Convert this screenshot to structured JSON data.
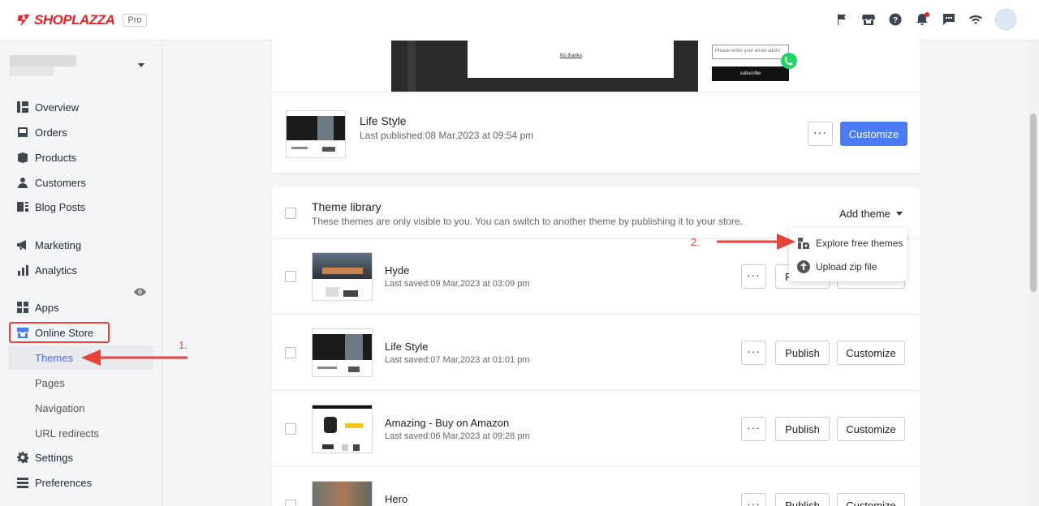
{
  "header": {
    "brand": "SHOPLAZZA",
    "plan": "Pro",
    "icons": [
      "flag-icon",
      "store-icon",
      "help-icon",
      "bell-icon",
      "chat-icon",
      "wifi-icon"
    ]
  },
  "sidebar": {
    "items": [
      {
        "label": "Overview",
        "icon": "overview-icon"
      },
      {
        "label": "Orders",
        "icon": "orders-icon"
      },
      {
        "label": "Products",
        "icon": "products-icon"
      },
      {
        "label": "Customers",
        "icon": "customers-icon"
      },
      {
        "label": "Blog Posts",
        "icon": "blog-icon"
      },
      {
        "label": "Marketing",
        "icon": "marketing-icon"
      },
      {
        "label": "Analytics",
        "icon": "analytics-icon"
      },
      {
        "label": "Apps",
        "icon": "apps-icon"
      },
      {
        "label": "Online Store",
        "icon": "online-store-icon"
      },
      {
        "label": "Settings",
        "icon": "settings-icon"
      },
      {
        "label": "Preferences",
        "icon": "preferences-icon"
      }
    ],
    "online_store_sub": [
      "Themes",
      "Pages",
      "Navigation",
      "URL redirects"
    ]
  },
  "preview": {
    "no_thanks": "No thanks",
    "email_placeholder": "Please enter your email addre",
    "subscribe": "subscribe"
  },
  "current_theme": {
    "name": "Life Style",
    "published": "Last published:08 Mar,2023 at 09:54 pm",
    "more": "···",
    "customize": "Customize"
  },
  "library": {
    "title": "Theme library",
    "subtitle": "These themes are only visible to you. You can switch to another theme by publishing it to your store.",
    "add_theme": "Add theme",
    "dropdown": [
      "Explore free themes",
      "Upload zip file"
    ],
    "publish": "Publish",
    "customize": "Customize",
    "more": "···",
    "themes": [
      {
        "name": "Hyde",
        "saved": "Last saved:09 Mar,2023 at 03:09 pm"
      },
      {
        "name": "Life Style",
        "saved": "Last saved:07 Mar,2023 at 01:01 pm"
      },
      {
        "name": "Amazing - Buy on Amazon",
        "saved": "Last saved:06 Mar,2023 at 09:28 pm"
      },
      {
        "name": "Hero",
        "saved": ""
      }
    ]
  },
  "annotations": {
    "step1": "1.",
    "step2": "2."
  },
  "colors": {
    "accent": "#4a7af6",
    "brand": "#e8222a",
    "annotation": "#e8423b"
  }
}
